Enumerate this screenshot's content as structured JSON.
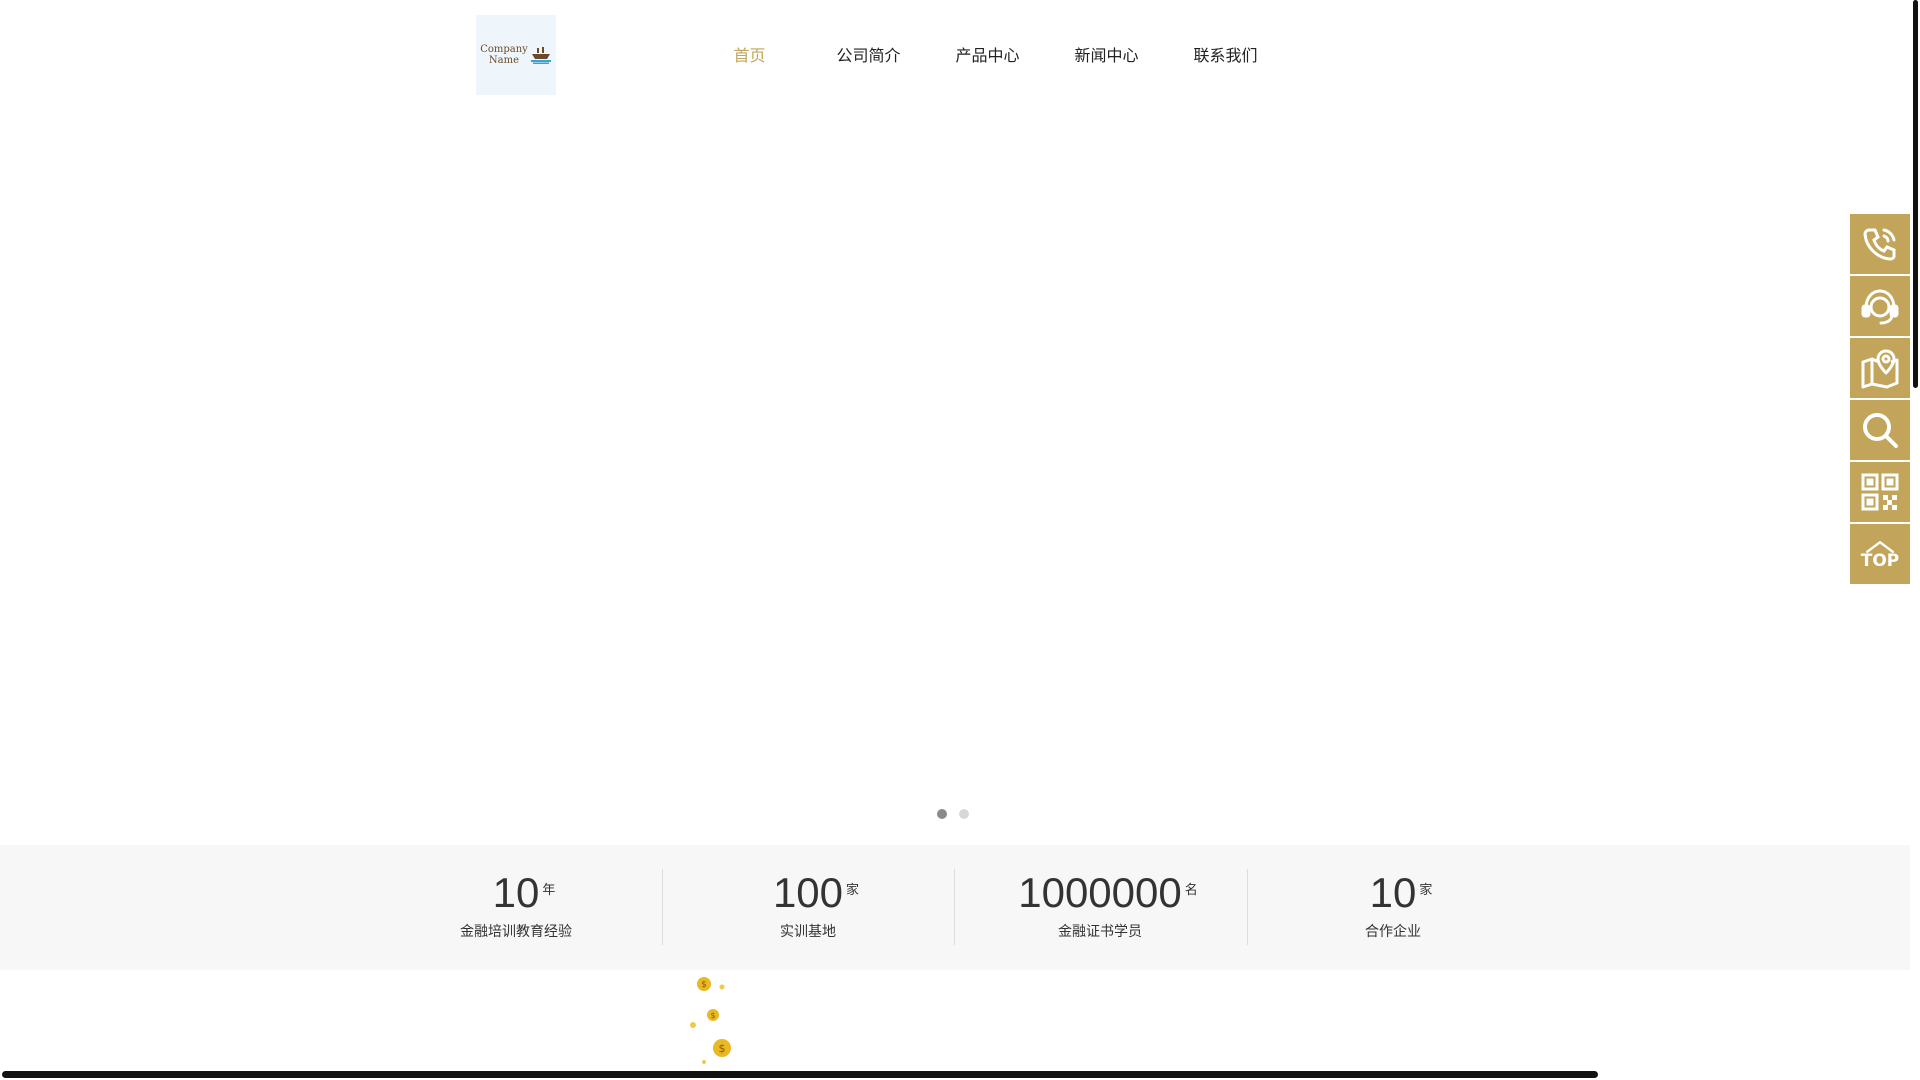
{
  "header": {
    "logo_line1": "Company",
    "logo_line2": "Name"
  },
  "nav": {
    "items": [
      {
        "label": "首页",
        "active": true
      },
      {
        "label": "公司简介"
      },
      {
        "label": "产品中心"
      },
      {
        "label": "新闻中心"
      },
      {
        "label": "联系我们"
      }
    ]
  },
  "banner": {
    "slides": 2,
    "current": 1
  },
  "stats": [
    {
      "number": "10",
      "unit": "年",
      "label": "金融培训教育经验"
    },
    {
      "number": "100",
      "unit": "家",
      "label": "实训基地"
    },
    {
      "number": "1000000",
      "unit": "名",
      "label": "金融证书学员"
    },
    {
      "number": "10",
      "unit": "家",
      "label": "合作企业"
    }
  ],
  "sidebar": {
    "buttons": [
      "phone-icon",
      "customer-service-icon",
      "map-location-icon",
      "search-icon",
      "qr-code-icon",
      "back-to-top-icon"
    ],
    "top_label": "TOP",
    "color": "#c2a55a"
  },
  "colors": {
    "accent": "#c2a55a",
    "stats_bg": "#f7f7f7"
  }
}
